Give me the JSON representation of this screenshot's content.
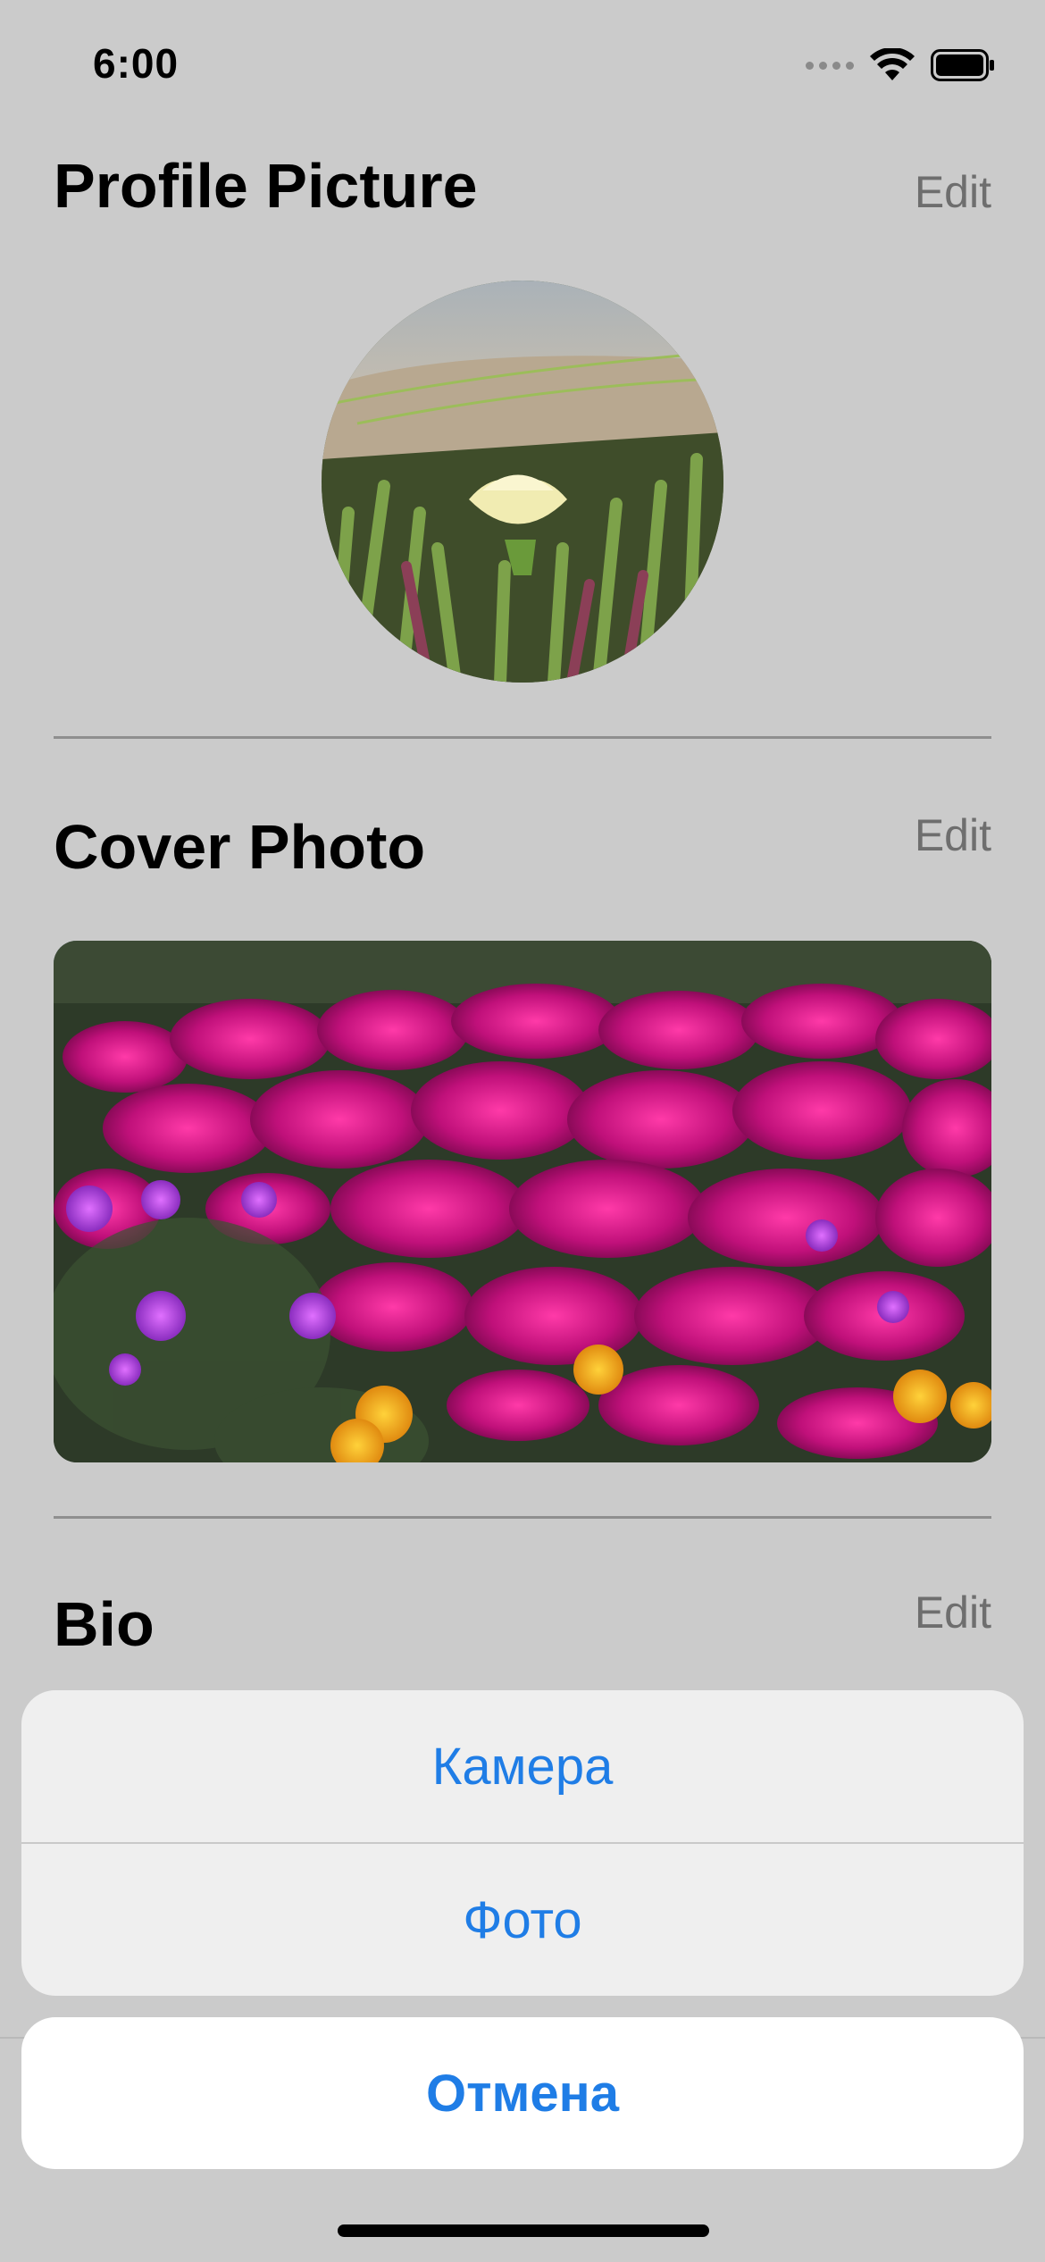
{
  "status_bar": {
    "time": "6:00"
  },
  "sections": {
    "profile_picture": {
      "title": "Profile Picture",
      "edit_label": "Edit"
    },
    "cover_photo": {
      "title": "Cover Photo",
      "edit_label": "Edit"
    },
    "bio": {
      "title": "Bio",
      "edit_label": "Edit"
    }
  },
  "action_sheet": {
    "actions": [
      {
        "label": "Камера"
      },
      {
        "label": "Фото"
      }
    ],
    "cancel_label": "Отмена"
  },
  "colors": {
    "background_dimmed": "#cbcbcb",
    "action_blue": "#1f7de6",
    "edit_gray": "#6e6e6e"
  },
  "icons": [
    "cellular-signal-icon",
    "wifi-icon",
    "battery-icon"
  ]
}
